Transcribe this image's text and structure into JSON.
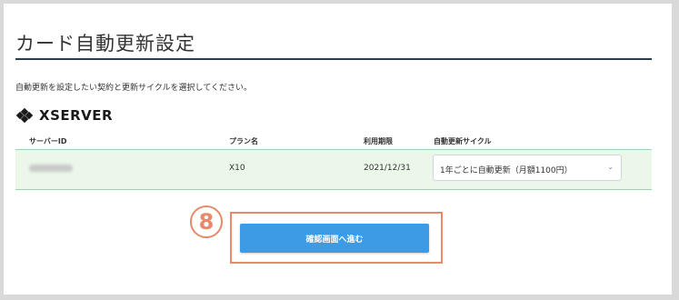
{
  "page": {
    "title": "カード自動更新設定",
    "description": "自動更新を設定したい契約と更新サイクルを選択してください。"
  },
  "logo": {
    "text": "XSERVER"
  },
  "table": {
    "headers": [
      "サーバーID",
      "プラン名",
      "利用期限",
      "自動更新サイクル"
    ],
    "rows": [
      {
        "plan": "X10",
        "expiry": "2021/12/31",
        "cycle": "1年ごとに自動更新（月額1100円）"
      }
    ]
  },
  "step_badge": "8",
  "confirm_button": "確認画面へ進む",
  "colors": {
    "accent": "#3d9be6",
    "highlight": "#e8896b",
    "row_bg": "#ebf7e9",
    "title_rule": "#2b3e50"
  }
}
